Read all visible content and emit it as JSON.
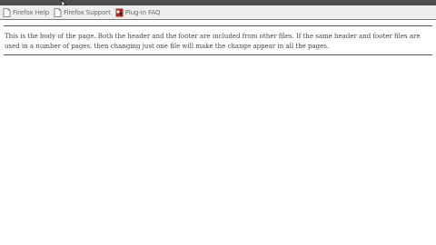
{
  "browser": {
    "bookmarks": [
      {
        "icon": "page-icon",
        "label": "Firefox Help"
      },
      {
        "icon": "page-icon",
        "label": "Firefox Support"
      },
      {
        "icon": "plugin-icon",
        "label": "Plug-in FAQ"
      }
    ]
  },
  "page": {
    "body_text": "This is the body of the page. Both the header and the footer are included from other files. If the same header and footer files are used in a number of pages, then changing just one file will make the change appear in all the pages."
  }
}
